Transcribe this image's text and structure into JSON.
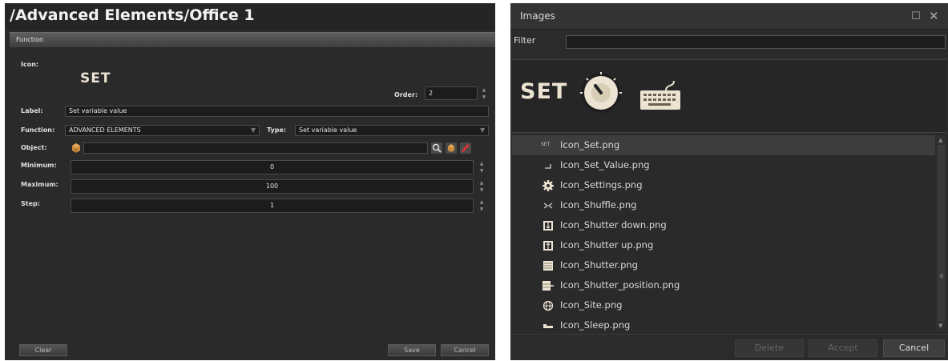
{
  "left_panel": {
    "title": "/Advanced Elements/Office 1",
    "section": "Function",
    "icon_label": "Icon:",
    "icon_preview_text": "SET",
    "order_label": "Order:",
    "order_value": "2",
    "label_label": "Label:",
    "label_value": "Set variable value",
    "function_label": "Function:",
    "function_value": "ADVANCED ELEMENTS",
    "type_label": "Type:",
    "type_value": "Set variable value",
    "object_label": "Object:",
    "object_value": "",
    "minimum_label": "Minimum:",
    "minimum_value": "0",
    "maximum_label": "Maximum:",
    "maximum_value": "100",
    "step_label": "Step:",
    "step_value": "1",
    "buttons": {
      "clear": "Clear",
      "save": "Save",
      "cancel": "Cancel"
    }
  },
  "right_panel": {
    "title": "Images",
    "filter_label": "Filter",
    "filter_value": "",
    "preview_set_text": "SET",
    "icon_small_set_text": "SET",
    "files": [
      {
        "name": "Icon_Set.png",
        "icon": "set-text-icon",
        "selected": true
      },
      {
        "name": "Icon_Set_Value.png",
        "icon": "set-value-icon",
        "selected": false
      },
      {
        "name": "Icon_Settings.png",
        "icon": "gear-icon",
        "selected": false
      },
      {
        "name": "Icon_Shuffle.png",
        "icon": "shuffle-icon",
        "selected": false
      },
      {
        "name": "Icon_Shutter down.png",
        "icon": "shutter-down-icon",
        "selected": false
      },
      {
        "name": "Icon_Shutter up.png",
        "icon": "shutter-up-icon",
        "selected": false
      },
      {
        "name": "Icon_Shutter.png",
        "icon": "shutter-icon",
        "selected": false
      },
      {
        "name": "Icon_Shutter_position.png",
        "icon": "shutter-position-icon",
        "selected": false
      },
      {
        "name": "Icon_Site.png",
        "icon": "globe-icon",
        "selected": false
      },
      {
        "name": "Icon_Sleep.png",
        "icon": "sleep-icon",
        "selected": false
      }
    ],
    "buttons": {
      "delete": "Delete",
      "accept": "Accept",
      "cancel": "Cancel"
    }
  },
  "colors": {
    "panel_bg": "#2a2a2a",
    "field_bg": "#1c1c1c",
    "icon_cream": "#ece3d2",
    "icon_gold": "#c9a44a"
  }
}
